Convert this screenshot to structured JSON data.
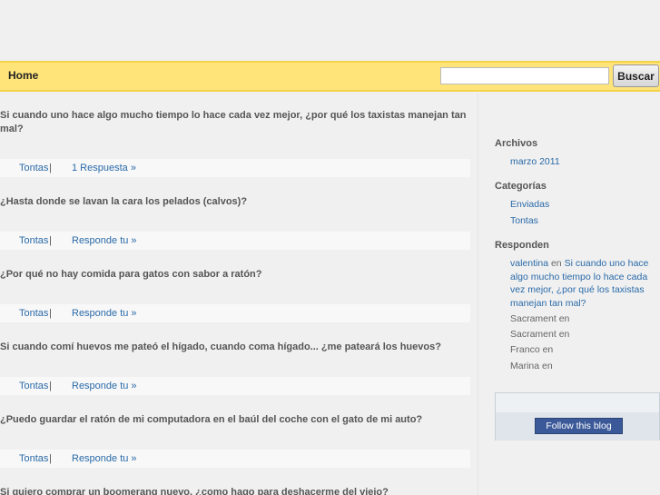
{
  "nav": {
    "home_label": "Home"
  },
  "search": {
    "placeholder": "",
    "value": "",
    "button_label": "Buscar"
  },
  "posts": [
    {
      "title": "Si cuando uno hace algo mucho tiempo lo hace cada vez mejor, ¿por qué los taxistas manejan tan mal?",
      "category": "Tontas",
      "separator": "|",
      "link": "1 Respuesta »"
    },
    {
      "title": "¿Hasta donde se lavan la cara los pelados (calvos)?",
      "category": "Tontas",
      "separator": "|",
      "link": "Responde tu »"
    },
    {
      "title": "¿Por qué no hay comida para gatos con sabor a ratón?",
      "category": "Tontas",
      "separator": "|",
      "link": "Responde tu »"
    },
    {
      "title": "Si cuando comí huevos me pateó el hígado, cuando coma hígado... ¿me pateará los huevos?",
      "category": "Tontas",
      "separator": "|",
      "link": "Responde tu »"
    },
    {
      "title": "¿Puedo guardar el ratón de mi computadora en el baúl del coche con el gato de mi auto?",
      "category": "Tontas",
      "separator": "|",
      "link": "Responde tu »"
    },
    {
      "title": "Si quiero comprar un boomerang nuevo, ¿como hago para deshacerme del viejo?"
    }
  ],
  "sidebar": {
    "archives": {
      "title": "Archivos",
      "items": [
        "marzo 2011"
      ]
    },
    "categories": {
      "title": "Categorías",
      "items": [
        "Enviadas",
        "Tontas"
      ]
    },
    "comments": {
      "title": "Responden",
      "first": {
        "author": "valentina",
        "word": "en",
        "post": "Si cuando uno hace algo mucho tiempo lo hace cada vez mejor, ¿por qué los taxistas manejan tan mal?"
      },
      "others": [
        "Sacrament en",
        "Sacrament en",
        "Franco en",
        "Marina en"
      ]
    },
    "follow": {
      "button_label": "Follow this blog"
    }
  },
  "colors": {
    "navbar": "#ffe47a",
    "link": "#2a6aa8",
    "follow_button": "#3b5998"
  }
}
